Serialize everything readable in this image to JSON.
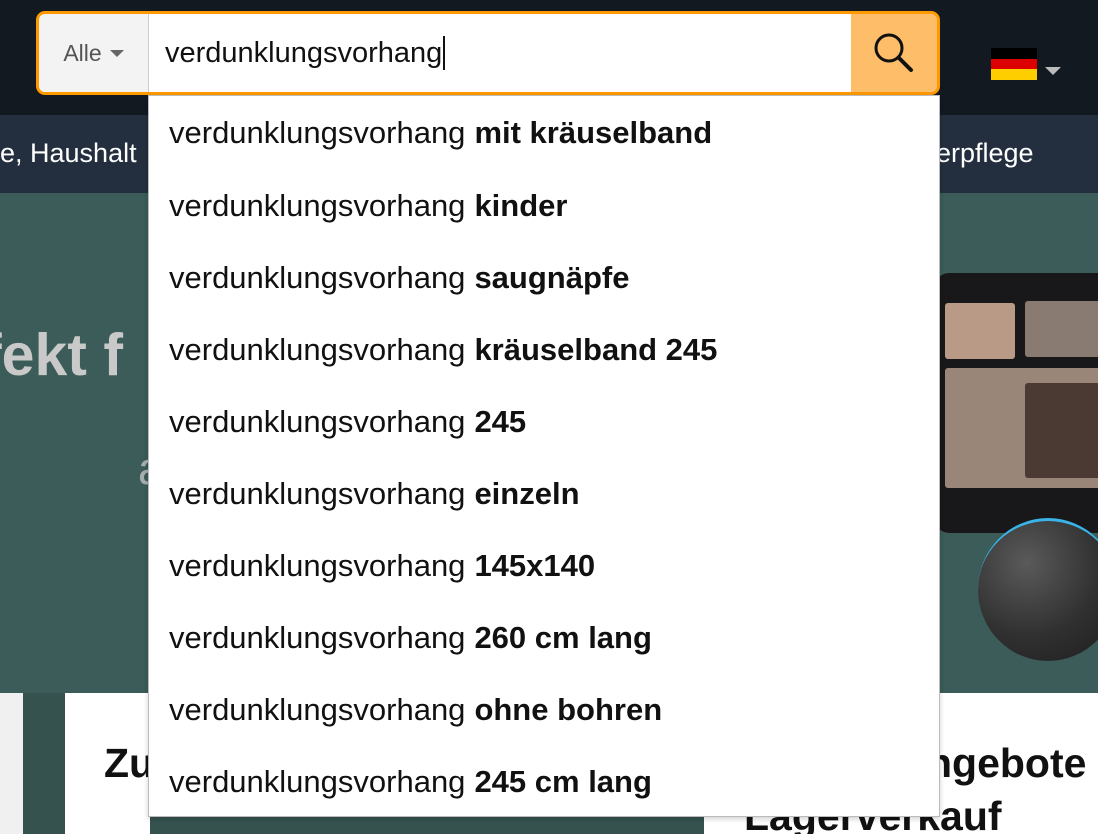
{
  "header": {
    "category": {
      "selected": "Alle"
    },
    "search": {
      "query": "verdunklungsvorhang"
    },
    "language": {
      "flag_colors": [
        "#000000",
        "#dd0000",
        "#ffce00"
      ]
    }
  },
  "nav": {
    "left_text": "e, Haushalt",
    "right_text": "erpflege"
  },
  "hero": {
    "headline": "fekt f",
    "partial_glyph": "a"
  },
  "cards": {
    "left_title": "Zu",
    "right_title": "ngebote",
    "right_title_second_line": "Lagerverkauf"
  },
  "suggestions": [
    {
      "prefix": "verdunklungsvorhang",
      "completion": "mit kräuselband"
    },
    {
      "prefix": "verdunklungsvorhang",
      "completion": "kinder"
    },
    {
      "prefix": "verdunklungsvorhang",
      "completion": "saugnäpfe"
    },
    {
      "prefix": "verdunklungsvorhang",
      "completion": "kräuselband 245"
    },
    {
      "prefix": "verdunklungsvorhang",
      "completion": "245"
    },
    {
      "prefix": "verdunklungsvorhang",
      "completion": "einzeln"
    },
    {
      "prefix": "verdunklungsvorhang",
      "completion": "145x140"
    },
    {
      "prefix": "verdunklungsvorhang",
      "completion": "260 cm lang"
    },
    {
      "prefix": "verdunklungsvorhang",
      "completion": "ohne bohren"
    },
    {
      "prefix": "verdunklungsvorhang",
      "completion": "245 cm lang"
    }
  ],
  "colors": {
    "header_background": "#131921",
    "navbar_background": "#232f3e",
    "search_accent": "#febd69",
    "search_focus_border": "#ff9900"
  },
  "icons": {
    "search": "search-icon",
    "dropdown": "chevron-down-icon",
    "language": "german-flag-icon"
  }
}
